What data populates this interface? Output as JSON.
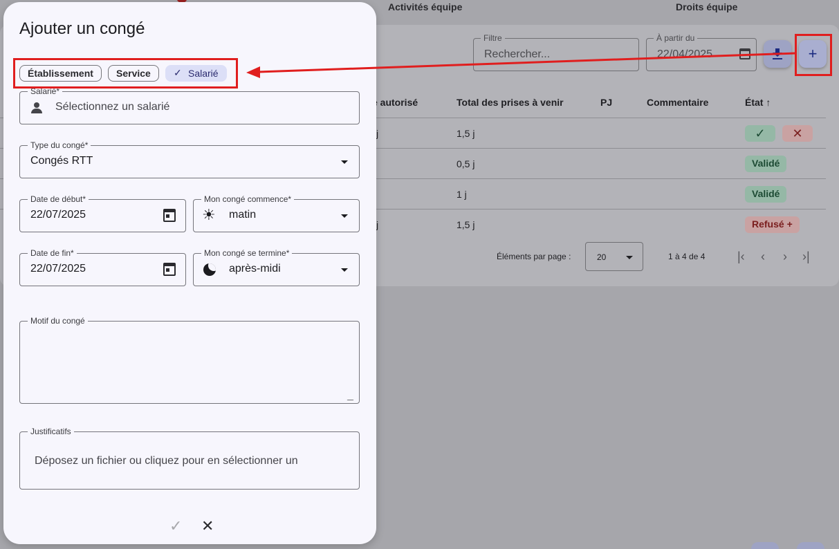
{
  "background": {
    "tabs": [
      "Activités équipe",
      "Droits équipe"
    ],
    "filter": {
      "label": "Filtre",
      "placeholder": "Rechercher..."
    },
    "from_date": {
      "label": "À partir du",
      "value": "22/04/2025"
    },
    "table": {
      "headers": [
        "e autorisé",
        "Total des prises à venir",
        "PJ",
        "Commentaire",
        "État ↑"
      ],
      "rows": [
        {
          "authorized": "j",
          "upcoming": "1,5 j",
          "status": "pending"
        },
        {
          "authorized": "",
          "upcoming": "0,5 j",
          "status": "Validé"
        },
        {
          "authorized": "",
          "upcoming": "1 j",
          "status": "Validé"
        },
        {
          "authorized": "j",
          "upcoming": "1,5 j",
          "status": "Refusé +"
        }
      ]
    },
    "pagination": {
      "per_page_label": "Éléments par page :",
      "per_page_value": "20",
      "range": "1 à 4 de 4"
    },
    "colors": {
      "validated": "#1c4a33",
      "refused": "#7a1e1e",
      "annotation": "#e01e1e"
    }
  },
  "dialog": {
    "title": "Ajouter un congé",
    "scope_chips": [
      {
        "label": "Établissement",
        "selected": false
      },
      {
        "label": "Service",
        "selected": false
      },
      {
        "label": "Salarié",
        "selected": true
      }
    ],
    "employee": {
      "label": "Salarié*",
      "placeholder": "Sélectionnez un salarié",
      "icon": "person-icon"
    },
    "leave_type": {
      "label": "Type du congé*",
      "value": "Congés RTT"
    },
    "start_date": {
      "label": "Date de début*",
      "value": "22/07/2025"
    },
    "start_period": {
      "label": "Mon congé commence*",
      "value": "matin",
      "icon": "sun-icon"
    },
    "end_date": {
      "label": "Date de fin*",
      "value": "22/07/2025"
    },
    "end_period": {
      "label": "Mon congé se termine*",
      "value": "après-midi",
      "icon": "moon-icon"
    },
    "reason": {
      "label": "Motif du congé",
      "value": ""
    },
    "attachments": {
      "label": "Justificatifs",
      "hint": "Déposez un fichier ou cliquez pour en sélectionner un"
    },
    "actions": {
      "confirm": "✓",
      "cancel": "✕"
    }
  }
}
